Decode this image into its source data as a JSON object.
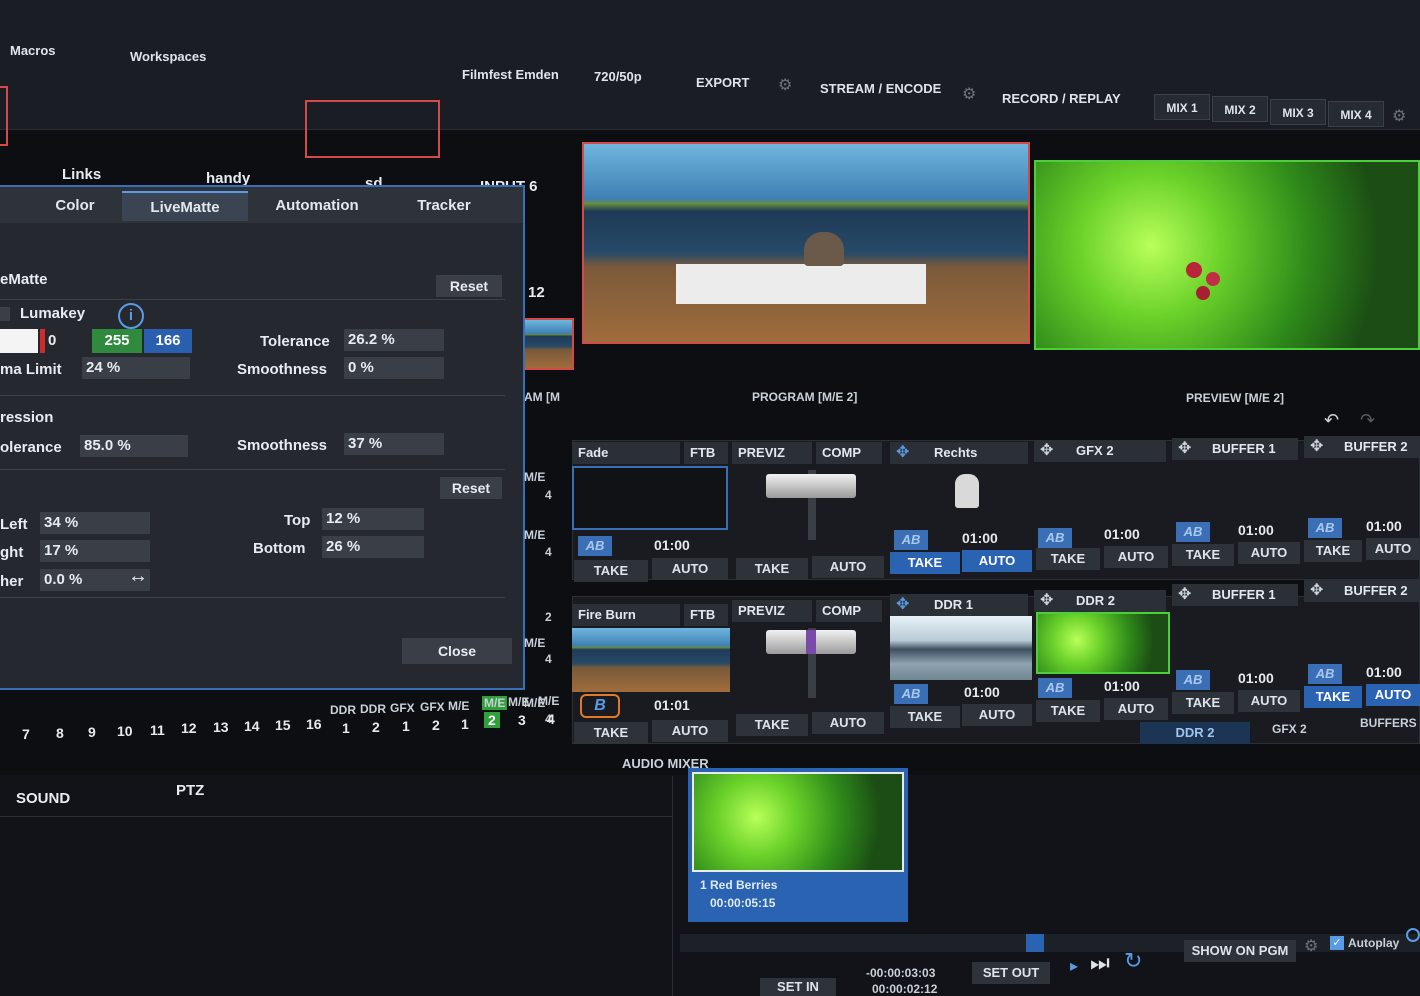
{
  "menu": {
    "macros": "Macros",
    "workspaces": "Workspaces"
  },
  "session": {
    "name": "Filmfest Emden",
    "format": "720/50p"
  },
  "toolbar": {
    "export": "EXPORT",
    "stream": "STREAM / ENCODE",
    "record": "RECORD / REPLAY"
  },
  "mix_tabs": [
    "MIX 1",
    "MIX 2",
    "MIX 3",
    "MIX 4"
  ],
  "inputs": {
    "links": "Links",
    "handy": "handy",
    "sd": "sd",
    "input6": "INPUT 6",
    "num12": "12"
  },
  "monitors": {
    "program": "PROGRAM [M/E 2]",
    "preview": "PREVIEW [M/E 2]",
    "left_partial": "AM [M"
  },
  "panel": {
    "tabs": [
      "Color",
      "LiveMatte",
      "Automation",
      "Tracker"
    ],
    "section1": "eMatte",
    "reset": "Reset",
    "lumakey": "Lumakey",
    "info_icon": "i",
    "color_values": [
      "0",
      "255",
      "166"
    ],
    "tolerance_label": "Tolerance",
    "tolerance_value": "26.2 %",
    "chroma_limit_label": "ma Limit",
    "chroma_limit_value": "24 %",
    "smoothness_label": "Smoothness",
    "smoothness_value": "0 %",
    "section2": "ression",
    "tolerance2_label": "olerance",
    "tolerance2_value": "85.0 %",
    "smoothness2_label": "Smoothness",
    "smoothness2_value": "37 %",
    "reset2": "Reset",
    "left_label": "Left",
    "left_value": "34 %",
    "right_label": "ght",
    "right_value": "17 %",
    "feather_label": "her",
    "feather_value": "0.0 %",
    "top_label": "Top",
    "top_value": "12 %",
    "bottom_label": "Bottom",
    "bottom_value": "26 %",
    "close": "Close"
  },
  "me_row1": {
    "transition": "Fade",
    "ftb": "FTB",
    "previz": "PREVIZ",
    "comp": "COMP",
    "ab": "AB",
    "time": "01:00",
    "take": "TAKE",
    "auto": "AUTO",
    "overlays": [
      {
        "name": "Rechts",
        "time": "01:00"
      },
      {
        "name": "GFX 2",
        "time": "01:00"
      },
      {
        "name": "BUFFER 1",
        "time": "01:00"
      },
      {
        "name": "BUFFER 2",
        "time": "01:00"
      }
    ],
    "side_labels": [
      "M/E",
      "4",
      "M/E",
      "4"
    ]
  },
  "me_row2": {
    "transition": "Fire Burn",
    "ftb": "FTB",
    "previz": "PREVIZ",
    "comp": "COMP",
    "ab": "B",
    "time": "01:01",
    "take": "TAKE",
    "auto": "AUTO",
    "overlays": [
      {
        "name": "DDR 1",
        "time": "01:00"
      },
      {
        "name": "DDR 2",
        "time": "01:00"
      },
      {
        "name": "BUFFER 1",
        "time": "01:00"
      },
      {
        "name": "BUFFER 2",
        "time": "01:00"
      }
    ],
    "side_labels": [
      "2",
      "M/E",
      "4",
      "M/E",
      "4"
    ]
  },
  "bus_numbers": [
    "7",
    "8",
    "9",
    "10",
    "11",
    "12",
    "13",
    "14",
    "15",
    "16"
  ],
  "bus_extra_top": [
    "DDR",
    "DDR",
    "GFX",
    "GFX",
    "M/E",
    "M/E",
    "M/E",
    "M/E"
  ],
  "bus_extra_bottom": [
    "1",
    "2",
    "1",
    "2",
    "1",
    "2",
    "3",
    "4"
  ],
  "bottom_tabs": [
    "DDR 2",
    "GFX 2",
    "BUFFERS"
  ],
  "audio": {
    "title": "AUDIO MIXER",
    "sound": "SOUND",
    "ptz": "PTZ"
  },
  "ddr": {
    "clip_title": "1  Red Berries",
    "clip_duration": "00:00:05:15",
    "show_on_pgm": "SHOW ON PGM",
    "autoplay": "Autoplay",
    "set_in": "SET IN",
    "set_out": "SET OUT",
    "time1": "-00:00:03:03",
    "time2": "00:00:02:12"
  },
  "colors": {
    "accent": "#3b6fb5",
    "program_red": "#d24a4a",
    "preview_green": "#4ccf3a",
    "panel": "#25292f"
  }
}
